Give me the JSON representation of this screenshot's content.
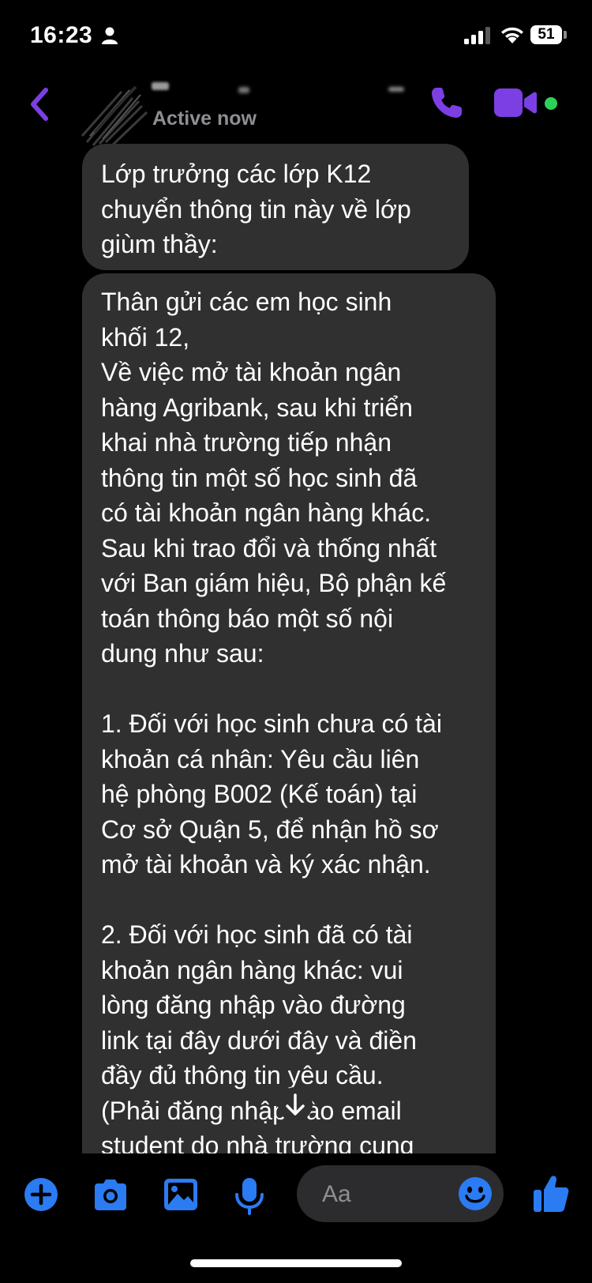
{
  "status_bar": {
    "time": "16:23",
    "battery": "51"
  },
  "header": {
    "status": "Active now"
  },
  "messages": [
    {
      "lines": [
        "Lớp trưởng các lớp K12",
        "chuyển thông tin này về lớp",
        "giùm thầy:"
      ]
    },
    {
      "lines": [
        "Thân gửi các em học sinh",
        "khối 12,",
        "Về việc mở tài khoản ngân",
        "hàng Agribank, sau khi triển",
        "khai nhà trường tiếp nhận",
        "thông tin một số học sinh đã",
        "có tài khoản ngân hàng khác.",
        "Sau khi trao đổi và thống nhất",
        "với Ban giám hiệu, Bộ phận kế",
        "toán thông báo một số nội",
        "dung như sau:",
        "",
        "1. Đối với học sinh chưa có tài",
        "khoản cá nhân: Yêu cầu liên",
        "hệ phòng B002 (Kế toán) tại",
        "Cơ sở Quận 5, để nhận hồ sơ",
        "mở tài khoản và ký xác nhận.",
        "",
        "2. Đối với học sinh đã có tài",
        "khoản ngân hàng khác: vui",
        "lòng đăng nhập vào đường",
        "link tại đây dưới đây và điền",
        "đầy đủ thông tin yêu cầu.",
        "(Phải đăng nhập vào email",
        "student do nhà trường cung"
      ]
    }
  ],
  "composer": {
    "placeholder": "Aa"
  },
  "colors": {
    "accent": "#7b3fe4",
    "composer_blue": "#2b7bf2",
    "bubble": "#303030",
    "online": "#2ed158"
  },
  "icons": [
    "back-icon",
    "phone-icon",
    "video-icon",
    "plus-icon",
    "camera-icon",
    "gallery-icon",
    "microphone-icon",
    "emoji-icon",
    "like-icon",
    "arrow-down-icon"
  ]
}
